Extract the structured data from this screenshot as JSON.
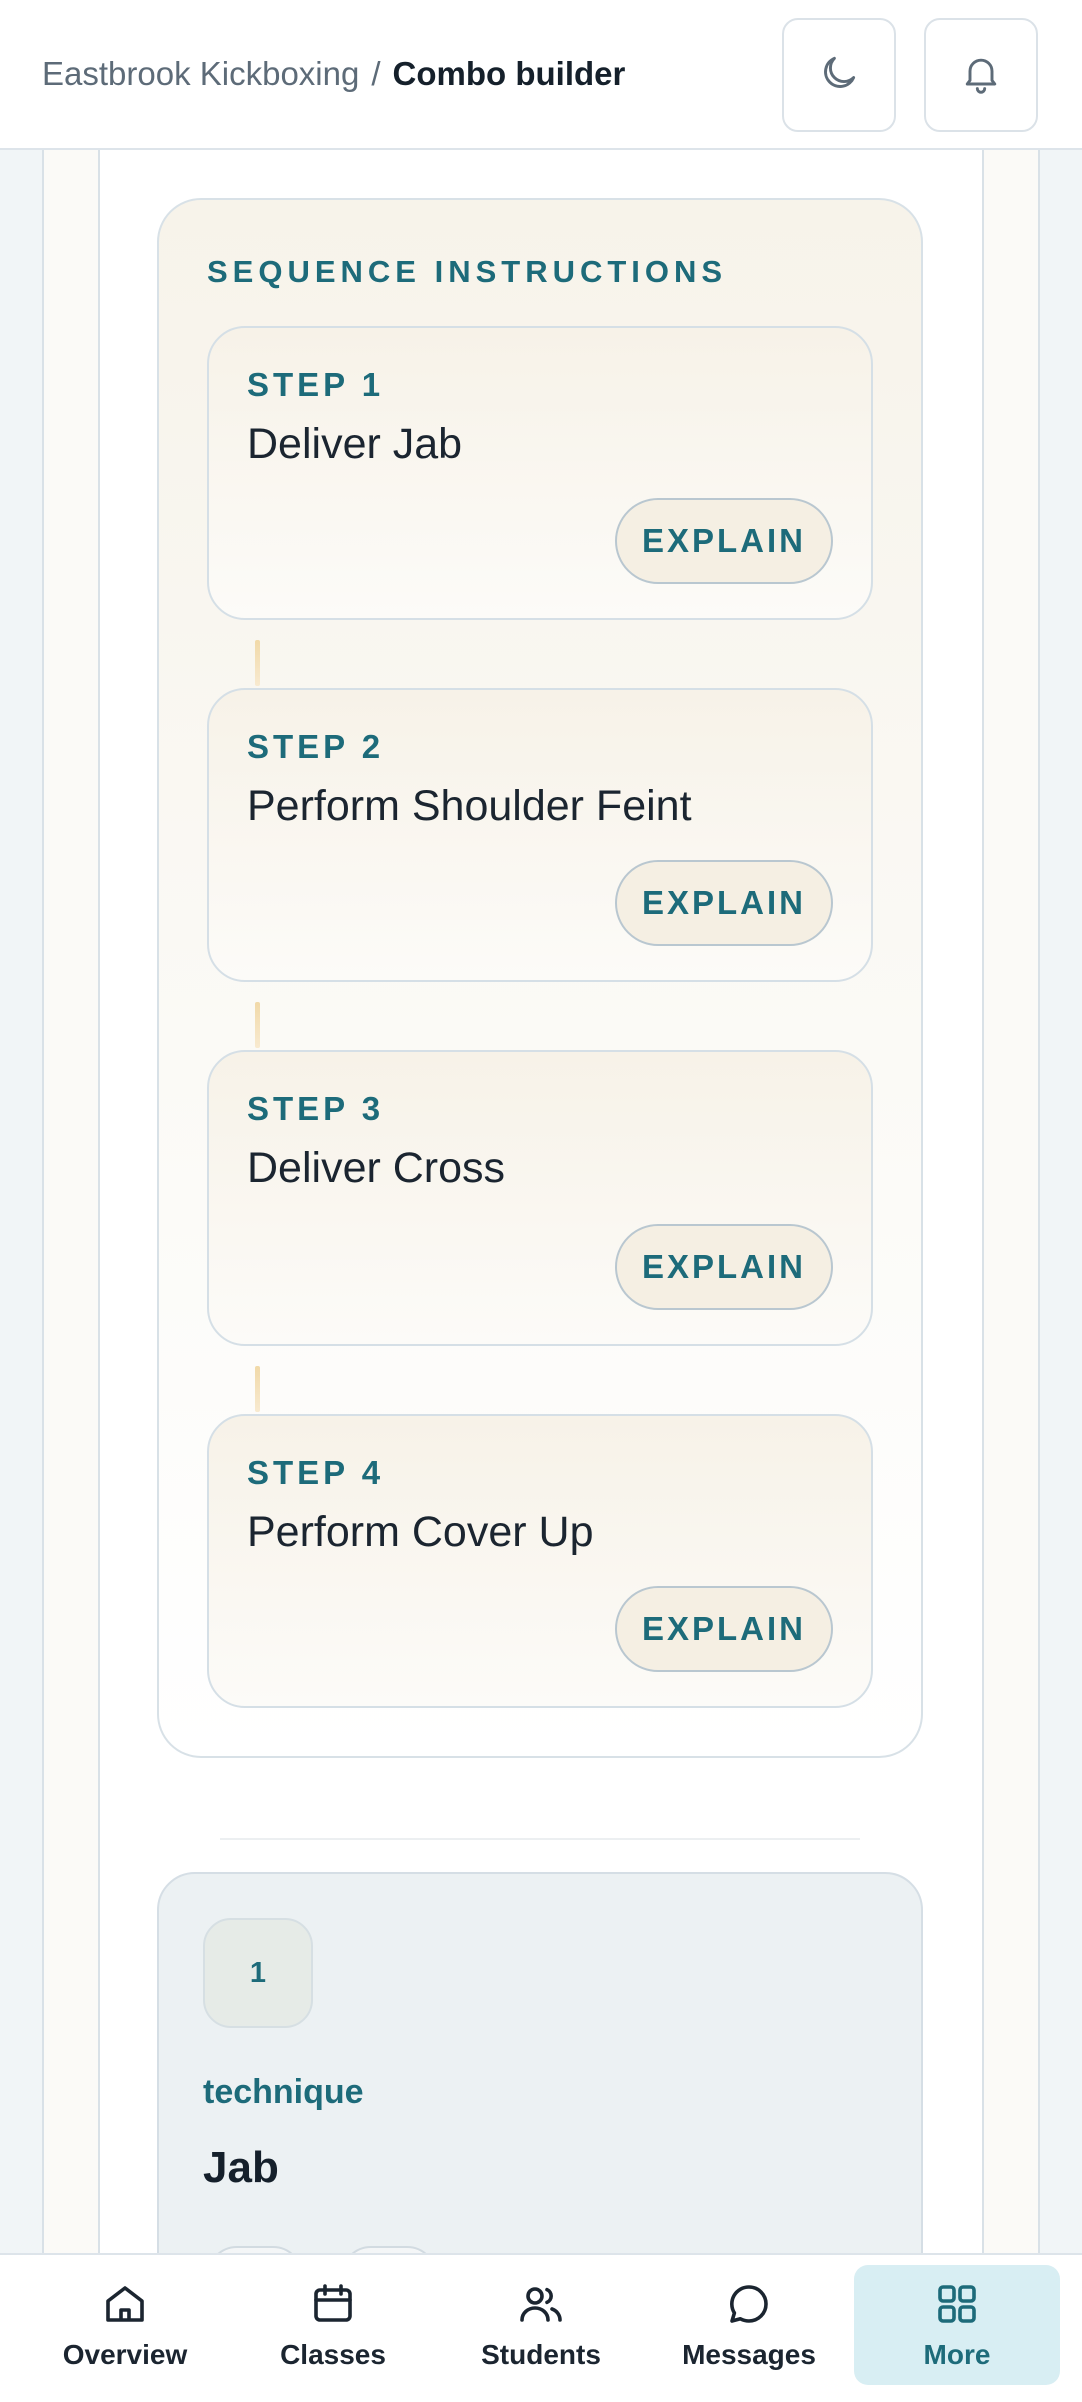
{
  "header": {
    "breadcrumb_parent": "Eastbrook Kickboxing",
    "breadcrumb_separator": "/",
    "breadcrumb_current": "Combo builder",
    "theme_toggle_icon": "moon-icon",
    "notifications_icon": "bell-icon"
  },
  "sequence": {
    "title": "SEQUENCE INSTRUCTIONS",
    "steps": [
      {
        "label": "STEP 1",
        "text": "Deliver Jab",
        "button": "EXPLAIN"
      },
      {
        "label": "STEP 2",
        "text": "Perform Shoulder Feint",
        "button": "EXPLAIN"
      },
      {
        "label": "STEP 3",
        "text": "Deliver Cross",
        "button": "EXPLAIN"
      },
      {
        "label": "STEP 4",
        "text": "Perform Cover Up",
        "button": "EXPLAIN"
      }
    ]
  },
  "technique_card": {
    "number": "1",
    "category": "technique",
    "name": "Jab"
  },
  "bottom_nav": {
    "items": [
      {
        "label": "Overview",
        "icon": "home-icon"
      },
      {
        "label": "Classes",
        "icon": "calendar-icon"
      },
      {
        "label": "Students",
        "icon": "users-icon"
      },
      {
        "label": "Messages",
        "icon": "message-icon"
      },
      {
        "label": "More",
        "icon": "grid-icon",
        "active": true
      }
    ]
  },
  "colors": {
    "accent": "#1d6b7a",
    "active_nav_bg": "#d8eef3"
  }
}
